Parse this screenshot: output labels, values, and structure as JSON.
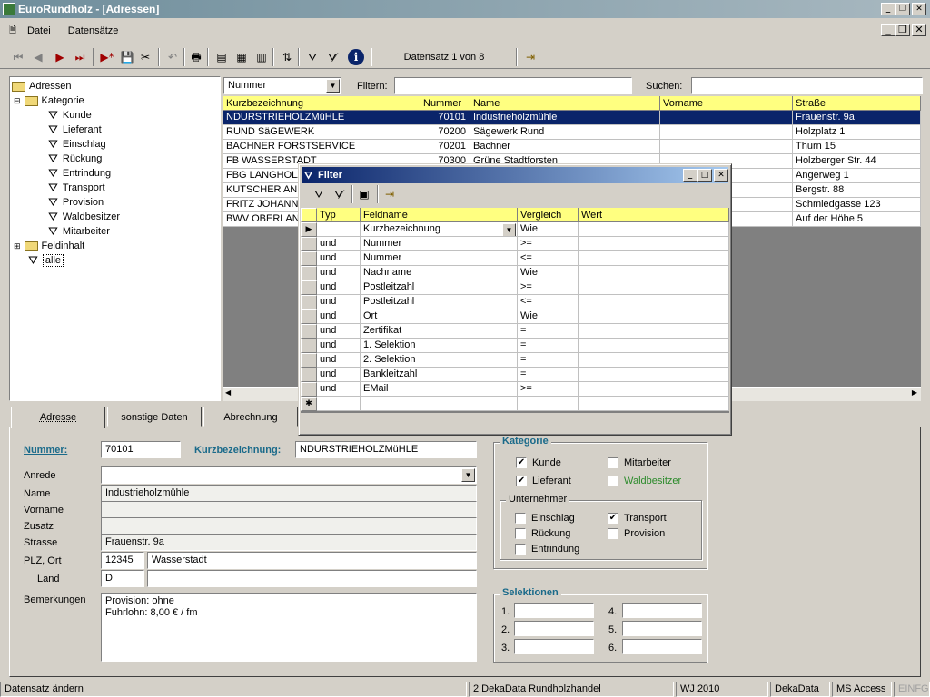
{
  "window": {
    "title": "EuroRundholz - [Adressen]"
  },
  "menu": {
    "items": [
      "Datei",
      "Datensätze"
    ]
  },
  "toolbar": {
    "record_info": "Datensatz 1 von 8"
  },
  "search": {
    "field_dropdown": "Nummer",
    "filter_label": "Filtern:",
    "filter_value": "",
    "search_label": "Suchen:",
    "search_value": ""
  },
  "tree": {
    "root": "Adressen",
    "kategorie": "Kategorie",
    "kategorie_items": [
      "Kunde",
      "Lieferant",
      "Einschlag",
      "Rückung",
      "Entrindung",
      "Transport",
      "Provision",
      "Waldbesitzer",
      "Mitarbeiter"
    ],
    "feldinhalt": "Feldinhalt",
    "alle": "alle"
  },
  "grid": {
    "columns": [
      "Kurzbezeichnung",
      "Nummer",
      "Name",
      "Vorname",
      "Straße"
    ],
    "rows": [
      [
        "NDURSTRIEHOLZMüHLE",
        "70101",
        "Industrieholzmühle",
        "",
        "Frauenstr. 9a"
      ],
      [
        "RUND SäGEWERK",
        "70200",
        "Sägewerk Rund",
        "",
        "Holzplatz 1"
      ],
      [
        "BACHNER FORSTSERVICE",
        "70201",
        "Bachner",
        "",
        "Thurn 15"
      ],
      [
        "FB WASSERSTADT",
        "70300",
        "Grüne Stadtforsten",
        "",
        "Holzberger Str. 44"
      ],
      [
        "FBG LANGHOLZ",
        "",
        "",
        "",
        "Angerweg 1"
      ],
      [
        "KUTSCHER AN",
        "",
        "",
        "",
        "Bergstr. 88"
      ],
      [
        "FRITZ JOHANN",
        "",
        "",
        "",
        "Schmiedgasse 123"
      ],
      [
        "BWV OBERLAN",
        "",
        "",
        "",
        "Auf der Höhe 5"
      ]
    ]
  },
  "filter_dialog": {
    "title": "Filter",
    "columns": [
      "Typ",
      "Feldname",
      "Vergleich",
      "Wert"
    ],
    "rows": [
      [
        "",
        "Kurzbezeichnung",
        "Wie",
        ""
      ],
      [
        "und",
        "Nummer",
        ">=",
        ""
      ],
      [
        "und",
        "Nummer",
        "<=",
        ""
      ],
      [
        "und",
        "Nachname",
        "Wie",
        ""
      ],
      [
        "und",
        "Postleitzahl",
        ">=",
        ""
      ],
      [
        "und",
        "Postleitzahl",
        "<=",
        ""
      ],
      [
        "und",
        "Ort",
        "Wie",
        ""
      ],
      [
        "und",
        "Zertifikat",
        "=",
        ""
      ],
      [
        "und",
        "1. Selektion",
        "=",
        ""
      ],
      [
        "und",
        "2. Selektion",
        "=",
        ""
      ],
      [
        "und",
        "Bankleitzahl",
        "=",
        ""
      ],
      [
        "und",
        "EMail",
        ">=",
        ""
      ]
    ]
  },
  "tabs": [
    "Adresse",
    "sonstige Daten",
    "Abrechnung"
  ],
  "form": {
    "nummer_label": "Nummer:",
    "nummer": "70101",
    "kurz_label": "Kurzbezeichnung:",
    "kurz": "NDURSTRIEHOLZMüHLE",
    "anrede_label": "Anrede",
    "anrede": "",
    "name_label": "Name",
    "name": "Industrieholzmühle",
    "vorname_label": "Vorname",
    "vorname": "",
    "zusatz_label": "Zusatz",
    "zusatz": "",
    "strasse_label": "Strasse",
    "strasse": "Frauenstr. 9a",
    "plz_label": "PLZ, Ort",
    "plz": "12345",
    "ort": "Wasserstadt",
    "land_label": "Land",
    "land": "D",
    "land_name": "",
    "bemerkungen_label": "Bemerkungen",
    "bemerkungen_line1": "Provision: ohne",
    "bemerkungen_line2": "Fuhrlohn: 8,00 € / fm"
  },
  "kategorie": {
    "title": "Kategorie",
    "kunde": "Kunde",
    "lieferant": "Lieferant",
    "mitarbeiter": "Mitarbeiter",
    "waldbesitzer": "Waldbesitzer",
    "unternehmer_title": "Unternehmer",
    "einschlag": "Einschlag",
    "rueckung": "Rückung",
    "entrindung": "Entrindung",
    "transport": "Transport",
    "provision": "Provision"
  },
  "selektionen": {
    "title": "Selektionen",
    "labels": [
      "1.",
      "2.",
      "3.",
      "4.",
      "5.",
      "6."
    ]
  },
  "status": {
    "left": "Datensatz ändern",
    "company": "2 DekaData Rundholzhandel",
    "wj": "WJ 2010",
    "vendor": "DekaData",
    "db": "MS Access",
    "mode": "EINFG"
  },
  "colors": {
    "selection": "#0a246a",
    "header_yellow": "#ffff80",
    "accent_label": "#1a6a8a",
    "waldbesitzer": "#2a8a2a"
  }
}
